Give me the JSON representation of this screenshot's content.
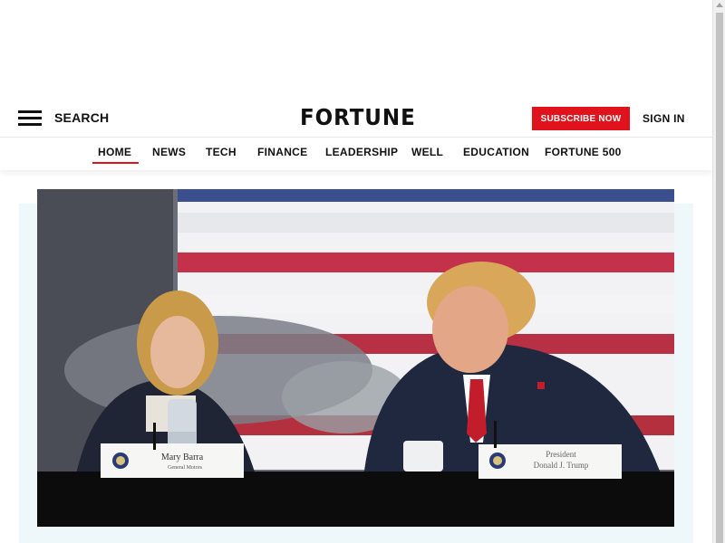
{
  "header": {
    "search_label": "SEARCH",
    "logo_text": "FORTUNE",
    "subscribe_label": "SUBSCRIBE NOW",
    "signin_label": "SIGN IN"
  },
  "nav": {
    "items": [
      {
        "label": "HOME",
        "active": true
      },
      {
        "label": "NEWS"
      },
      {
        "label": "TECH"
      },
      {
        "label": "FINANCE"
      },
      {
        "label": "LEADERSHIP"
      },
      {
        "label": "WELL"
      },
      {
        "label": "EDUCATION"
      },
      {
        "label": "FORTUNE 500"
      }
    ]
  },
  "hero": {
    "nameplate_left_name": "Mary Barra",
    "nameplate_left_org": "General Motors",
    "nameplate_right_title": "President",
    "nameplate_right_name": "Donald J. Trump"
  },
  "colors": {
    "accent": "#e0121b",
    "hero_bg": "#eef8fb"
  }
}
